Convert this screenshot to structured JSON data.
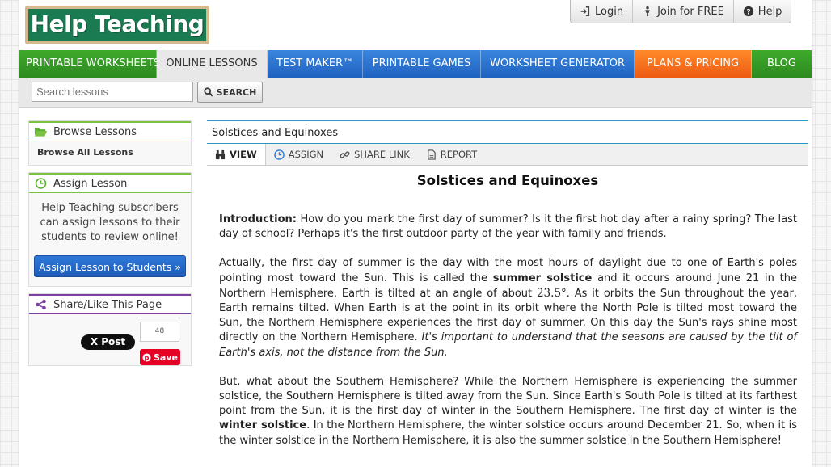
{
  "brand": {
    "logo_text": "Help Teaching",
    "green": "#1a7a52"
  },
  "topbar": {
    "login": "Login",
    "join": "Join for FREE",
    "help": "Help"
  },
  "nav": [
    {
      "label": "PRINTABLE WORKSHEETS",
      "color": "green"
    },
    {
      "label": "ONLINE LESSONS",
      "color": "active"
    },
    {
      "label": "TEST MAKER™",
      "color": "blue"
    },
    {
      "label": "PRINTABLE GAMES",
      "color": "blue"
    },
    {
      "label": "WORKSHEET GENERATOR",
      "color": "blue"
    },
    {
      "label": "PLANS & PRICING",
      "color": "orange"
    },
    {
      "label": "BLOG",
      "color": "green"
    }
  ],
  "search": {
    "placeholder": "Search lessons",
    "button": "SEARCH"
  },
  "sidebar": {
    "browse": {
      "title": "Browse Lessons",
      "link": "Browse All Lessons"
    },
    "assign": {
      "title": "Assign Lesson",
      "text": "Help Teaching subscribers can assign lessons to their students to review online!",
      "button": "Assign Lesson to Students »"
    },
    "share": {
      "title": "Share/Like This Page",
      "x_post": "X Post",
      "pin_count": "48",
      "pin_save": "Save"
    }
  },
  "main": {
    "breadcrumb": "Solstices and Equinoxes",
    "tabs": {
      "view": "VIEW",
      "assign": "ASSIGN",
      "share": "SHARE LINK",
      "report": "REPORT"
    },
    "title": "Solstices and Equinoxes",
    "p1": {
      "lead": "Introduction:",
      "text": " How do you mark the first day of summer? Is it the first hot day after a rainy spring? The last day of school? Perhaps it's the first outdoor party of the year with family and friends."
    },
    "p2": {
      "a": "Actually, the first day of summer is the day with the most hours of daylight due to one of Earth's poles pointing most toward the Sun. This is called the ",
      "b": "summer solstice",
      "c": " and it occurs around June 21 in the Northern Hemisphere. Earth is tilted at an angle of about ",
      "d": "23.5°",
      "e": ". As it orbits the Sun throughout the year, Earth remains tilted. When Earth is at the point in its orbit where the North Pole is tilted most toward the Sun, the Northern Hemisphere experiences the first day of summer. On this day the Sun's rays shine most directly on the Northern Hemisphere. ",
      "f": "It's important to understand that the seasons are caused by the tilt of Earth's axis, not the distance from the Sun."
    },
    "p3": {
      "a": "But, what about the Southern Hemisphere? While the Northern Hemisphere is experiencing the summer solstice, the Southern Hemisphere is tilted away from the Sun. Since Earth's South Pole is tilted at its farthest point from the Sun, it is the first day of winter in the Southern Hemisphere. The first day of winter is the ",
      "b": "winter solstice",
      "c": ". In the Northern Hemisphere, the winter solstice occurs around December 21. So, when it is the winter solstice in the Northern Hemisphere, it is also the summer solstice in the Southern Hemisphere!"
    }
  }
}
